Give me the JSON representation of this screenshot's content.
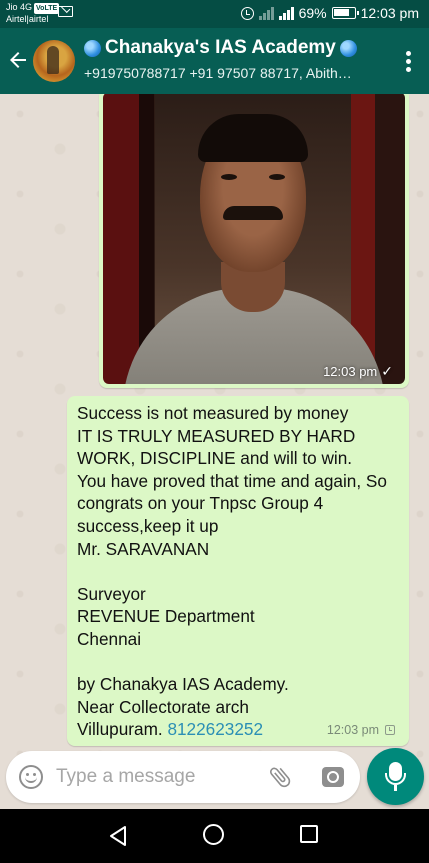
{
  "status_bar": {
    "carrier_top": "Jio 4G",
    "carrier_badge": "VoLTE",
    "carrier_bottom": "Airtel|airtel",
    "battery": "69%",
    "time": "12:03 pm"
  },
  "header": {
    "title": "Chanakya's IAS Academy",
    "subtitle": "+919750788717 +91 97507 88717, Abith…"
  },
  "messages": [
    {
      "type": "image",
      "time": "12:03 pm",
      "status": "sent"
    },
    {
      "type": "text",
      "text": "Success is not measured by money\nIT IS TRULY MEASURED BY HARD WORK, DISCIPLINE and will to win.\nYou have proved that time and again, So congrats on your Tnpsc Group 4 success,keep it up\nMr. SARAVANAN\n\nSurveyor\nREVENUE  Department\nChennai\n\nby Chanakya IAS Academy.\nNear Collectorate arch\nVillupuram. ",
      "phone": "8122623252",
      "time": "12:03 pm",
      "status": "pending"
    }
  ],
  "composer": {
    "placeholder": "Type a message"
  },
  "colors": {
    "app_bar": "#075e54",
    "status_bar": "#054d44",
    "bubble_out": "#dcf8c6",
    "mic_button": "#00897b",
    "link": "#2b8fb5"
  }
}
